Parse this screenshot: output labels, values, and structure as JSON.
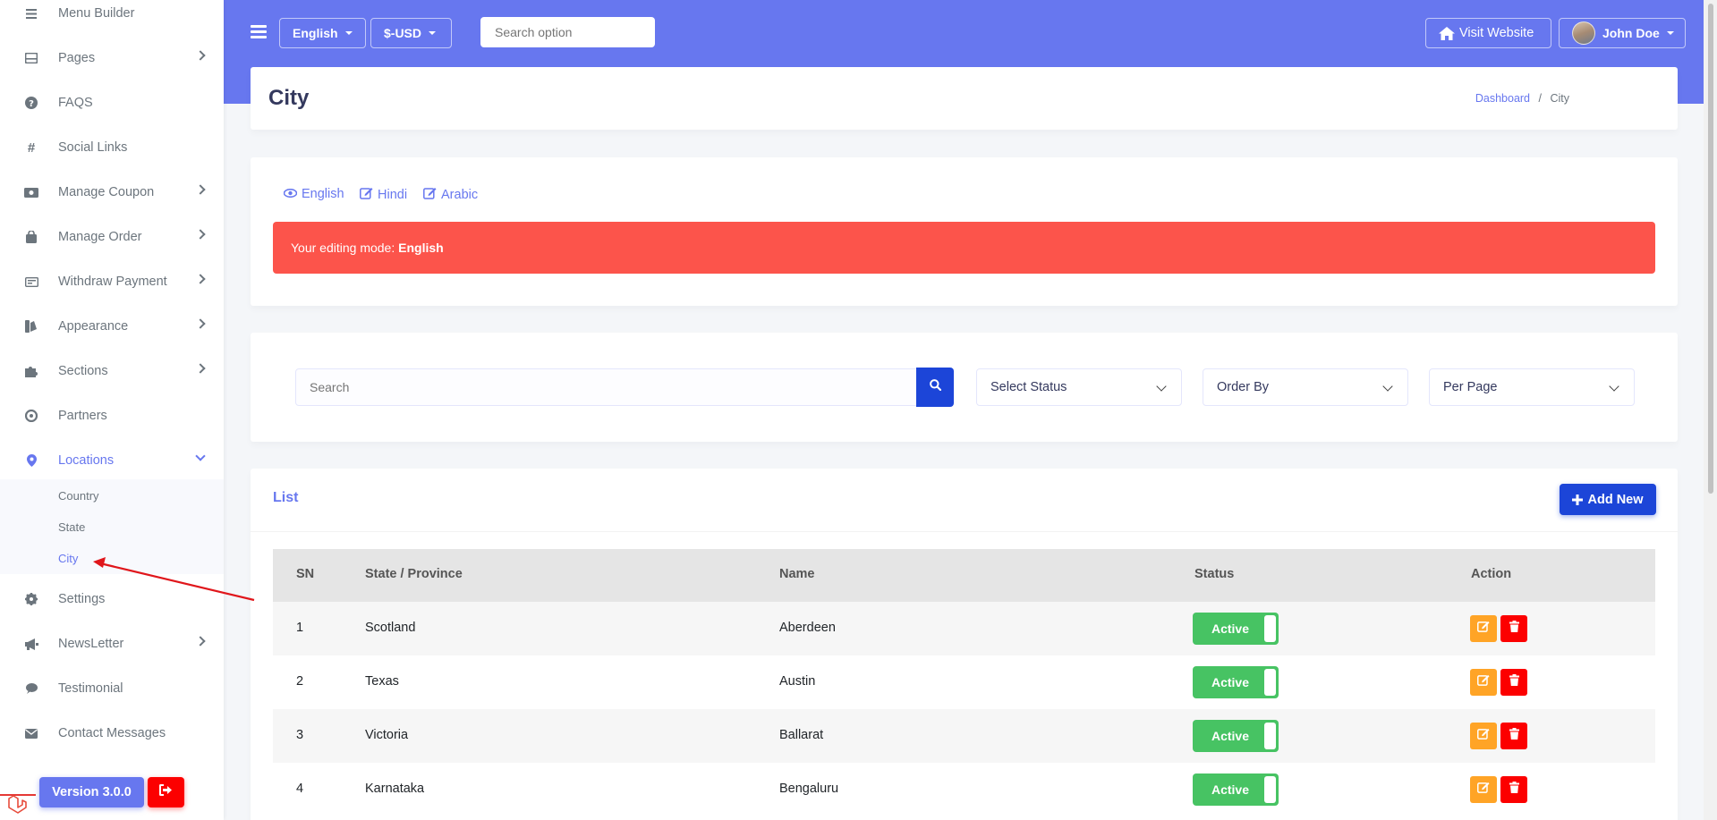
{
  "sidebar": {
    "items": [
      {
        "label": "Menu Builder",
        "icon": "bars-icon"
      },
      {
        "label": "Pages",
        "icon": "pages-icon"
      },
      {
        "label": "FAQS",
        "icon": "question-circle-icon"
      },
      {
        "label": "Social Links",
        "icon": "hash-icon"
      },
      {
        "label": "Manage Coupon",
        "icon": "ticket-icon"
      },
      {
        "label": "Manage Order",
        "icon": "shopping-bag-icon"
      },
      {
        "label": "Withdraw Payment",
        "icon": "money-icon"
      },
      {
        "label": "Appearance",
        "icon": "palette-icon"
      },
      {
        "label": "Sections",
        "icon": "puzzle-icon"
      },
      {
        "label": "Partners",
        "icon": "handshake-icon"
      },
      {
        "label": "Locations",
        "icon": "map-marker-icon"
      },
      {
        "label": "Settings",
        "icon": "gear-icon"
      },
      {
        "label": "NewsLetter",
        "icon": "bullhorn-icon"
      },
      {
        "label": "Testimonial",
        "icon": "comment-icon"
      },
      {
        "label": "Contact Messages",
        "icon": "envelope-icon"
      }
    ],
    "locations_sub": [
      "Country",
      "State",
      "City"
    ],
    "version": "Version 3.0.0"
  },
  "navbar": {
    "language": "English",
    "currency": "$-USD",
    "search_placeholder": "Search option",
    "visit_website": "Visit Website",
    "user_name": "John Doe"
  },
  "page": {
    "title": "City",
    "breadcrumb_home": "Dashboard",
    "breadcrumb_sep": "/",
    "breadcrumb_current": "City"
  },
  "languages": {
    "english": "English",
    "hindi": "Hindi",
    "arabic": "Arabic"
  },
  "alert": {
    "prefix": "Your editing mode:",
    "language": "English"
  },
  "filters": {
    "search_placeholder": "Search",
    "status": "Select Status",
    "order_by": "Order By",
    "per_page": "Per Page"
  },
  "list": {
    "title": "List",
    "add_new": "Add New",
    "headers": [
      "SN",
      "State / Province",
      "Name",
      "Status",
      "Action"
    ],
    "rows": [
      {
        "sn": "1",
        "state": "Scotland",
        "name": "Aberdeen",
        "status": "Active"
      },
      {
        "sn": "2",
        "state": "Texas",
        "name": "Austin",
        "status": "Active"
      },
      {
        "sn": "3",
        "state": "Victoria",
        "name": "Ballarat",
        "status": "Active"
      },
      {
        "sn": "4",
        "state": "Karnataka",
        "name": "Bengaluru",
        "status": "Active"
      }
    ]
  },
  "colors": {
    "primary": "#6777ef",
    "alert": "#fc544b",
    "success": "#47c363",
    "warning": "#ffa426",
    "danger": "#fc0000",
    "button_blue": "#1c45d8"
  }
}
